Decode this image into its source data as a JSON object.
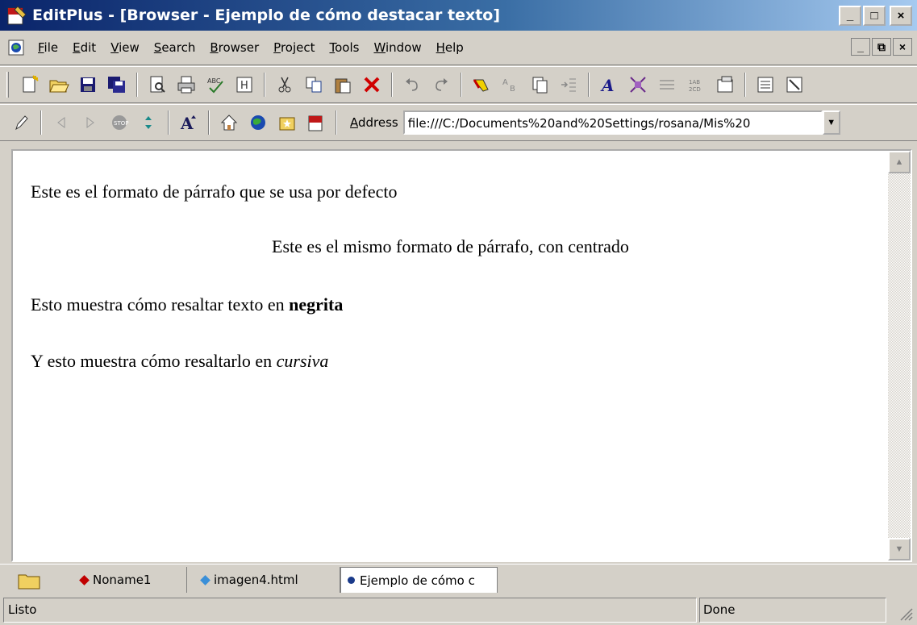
{
  "window": {
    "title": "EditPlus - [Browser - Ejemplo de cómo destacar texto]",
    "minimize": "_",
    "maximize": "□",
    "close": "×"
  },
  "menu": [
    {
      "label": "File",
      "u": "F",
      "rest": "ile"
    },
    {
      "label": "Edit",
      "u": "E",
      "rest": "dit"
    },
    {
      "label": "View",
      "u": "V",
      "rest": "iew"
    },
    {
      "label": "Search",
      "u": "S",
      "rest": "earch"
    },
    {
      "label": "Browser",
      "u": "B",
      "rest": "rowser"
    },
    {
      "label": "Project",
      "u": "P",
      "rest": "roject"
    },
    {
      "label": "Tools",
      "u": "T",
      "rest": "ools"
    },
    {
      "label": "Window",
      "u": "W",
      "rest": "indow"
    },
    {
      "label": "Help",
      "u": "H",
      "rest": "elp"
    }
  ],
  "mdi": {
    "minimize": "_",
    "restore": "⧉",
    "close": "×"
  },
  "address": {
    "label_u": "A",
    "label_rest": "ddress",
    "value": "file:///C:/Documents%20and%20Settings/rosana/Mis%20"
  },
  "content": {
    "p1": "Este es el formato de párrafo que se usa por defecto",
    "p2": "Este es el mismo formato de párrafo, con centrado",
    "p3_text": "Esto muestra cómo resaltar texto en ",
    "p3_bold": "negrita",
    "p4_text": "Y esto muestra cómo resaltarlo en ",
    "p4_italic": "cursiva"
  },
  "tabs": [
    {
      "label": "Noname1",
      "color": "#c00000"
    },
    {
      "label": "imagen4.html",
      "color": "#3a8fd8"
    },
    {
      "label": "Ejemplo de cómo c",
      "color": "#1a3a8a"
    }
  ],
  "status": {
    "left": "Listo",
    "right": "Done"
  },
  "colors": {
    "titlebar_start": "#0a246a",
    "titlebar_end": "#a6caf0",
    "chrome": "#d4d0c8"
  }
}
